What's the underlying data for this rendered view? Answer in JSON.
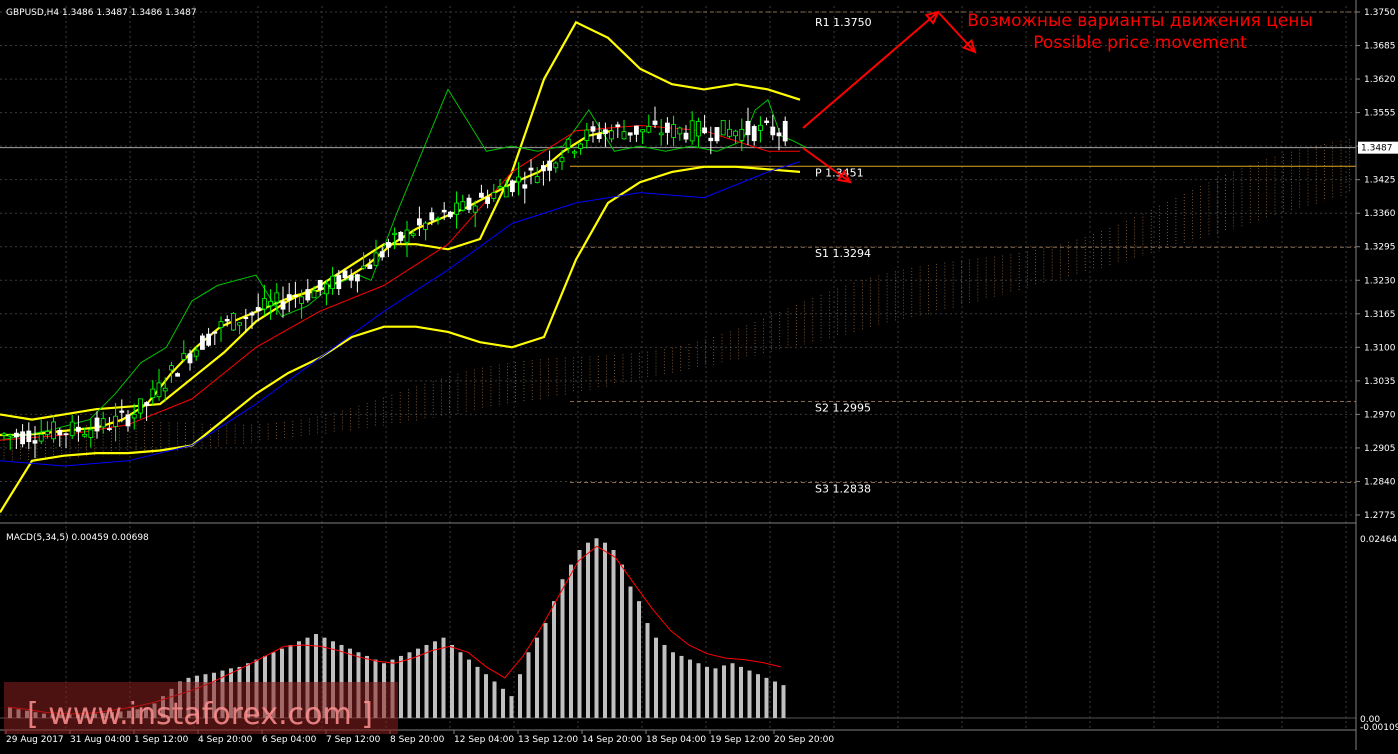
{
  "header": {
    "symbol_info": "GBPUSD,H4  1.3486 1.3487 1.3486 1.3487",
    "macd_info": "MACD(5,34,5) 0.00459 0.00698"
  },
  "annotation": {
    "ru": "Возможные варианты движения цены",
    "en": "Possible price movement"
  },
  "watermark": "[ www.instaforex.com ]",
  "colors": {
    "background": "#000000",
    "grid": "#3a3a3a",
    "bollinger": "#ffff00",
    "green_line": "#00c000",
    "red_line": "#ff0000",
    "blue_line": "#0000ff",
    "cloud": "#f4a460",
    "pivot": "#daa520",
    "histogram": "#c0c0c0",
    "signal": "#ff0000",
    "annotation": "#ff0000",
    "watermark": "#ff6060"
  },
  "chart_data": [
    {
      "type": "line",
      "title": "GBPUSD,H4",
      "ylim": [
        1.2775,
        1.375
      ],
      "grid": true,
      "y_ticks": [
        "1.3750",
        "1.3685",
        "1.3620",
        "1.3555",
        "1.3490",
        "1.3425",
        "1.3360",
        "1.3295",
        "1.3230",
        "1.3165",
        "1.3100",
        "1.3035",
        "1.2970",
        "1.2905",
        "1.2840",
        "1.2775"
      ],
      "x_ticks": [
        "29 Aug 2017",
        "31 Aug 04:00",
        "1 Sep 12:00",
        "4 Sep 20:00",
        "6 Sep 04:00",
        "7 Sep 12:00",
        "8 Sep 20:00",
        "12 Sep 04:00",
        "13 Sep 12:00",
        "14 Sep 20:00",
        "18 Sep 04:00",
        "19 Sep 12:00",
        "20 Sep 20:00"
      ],
      "current_price": "1.3487",
      "pivot_levels": [
        {
          "label": "R1 1.3750",
          "value": 1.375
        },
        {
          "label": "P 1.3451",
          "value": 1.3451
        },
        {
          "label": "S1 1.3294",
          "value": 1.3294
        },
        {
          "label": "S2 1.2995",
          "value": 1.2995
        },
        {
          "label": "S3 1.2838",
          "value": 1.2838
        }
      ],
      "series": [
        {
          "x": [
            0,
            5,
            10,
            15,
            20,
            25,
            30,
            35,
            40,
            45,
            50,
            55,
            60,
            65,
            70,
            75,
            80,
            85,
            90,
            95,
            100,
            105,
            110,
            115,
            120,
            125
          ],
          "values": [
            1.293,
            1.293,
            1.2935,
            1.294,
            1.2945,
            1.296,
            1.299,
            1.305,
            1.31,
            1.314,
            1.316,
            1.318,
            1.32,
            1.321,
            1.323,
            1.326,
            1.33,
            1.333,
            1.335,
            1.337,
            1.3395,
            1.342,
            1.344,
            1.348,
            1.351,
            1.352
          ]
        },
        {
          "x": [
            0,
            5,
            10,
            15,
            20,
            25,
            30,
            35,
            40,
            45,
            50,
            55,
            60,
            65,
            70,
            75,
            80,
            85,
            90,
            95,
            100,
            105,
            110,
            115,
            120,
            125
          ],
          "values": [
            1.297,
            1.296,
            1.297,
            1.298,
            1.2985,
            1.299,
            1.304,
            1.309,
            1.315,
            1.319,
            1.322,
            1.326,
            1.33,
            1.33,
            1.329,
            1.331,
            1.344,
            1.362,
            1.373,
            1.37,
            1.364,
            1.361,
            1.36,
            1.361,
            1.36,
            1.358
          ]
        },
        {
          "x": [
            0,
            5,
            10,
            15,
            20,
            25,
            30,
            35,
            40,
            45,
            50,
            55,
            60,
            65,
            70,
            75,
            80,
            85,
            90,
            95,
            100,
            105,
            110,
            115,
            120,
            125
          ],
          "values": [
            1.278,
            1.288,
            1.289,
            1.2895,
            1.2895,
            1.29,
            1.291,
            1.296,
            1.301,
            1.305,
            1.308,
            1.312,
            1.314,
            1.314,
            1.313,
            1.311,
            1.31,
            1.312,
            1.327,
            1.338,
            1.342,
            1.344,
            1.345,
            1.345,
            1.3445,
            1.344
          ]
        },
        {
          "x": [
            0,
            8,
            14,
            18,
            22,
            26,
            30,
            34,
            40,
            44,
            48,
            52,
            56,
            58,
            62,
            66,
            70,
            72,
            76,
            80,
            84,
            88,
            92,
            96,
            100,
            104,
            108,
            112,
            116,
            118,
            120,
            122,
            124,
            126
          ],
          "values": [
            1.292,
            1.294,
            1.296,
            1.301,
            1.307,
            1.31,
            1.319,
            1.322,
            1.324,
            1.316,
            1.318,
            1.322,
            1.324,
            1.323,
            1.336,
            1.348,
            1.36,
            1.356,
            1.348,
            1.349,
            1.348,
            1.349,
            1.356,
            1.348,
            1.349,
            1.348,
            1.349,
            1.348,
            1.35,
            1.356,
            1.358,
            1.351,
            1.35,
            1.3487
          ]
        },
        {
          "x": [
            0,
            10,
            20,
            30,
            40,
            50,
            60,
            70,
            80,
            90,
            100,
            110,
            120,
            125
          ],
          "values": [
            1.288,
            1.287,
            1.288,
            1.291,
            1.299,
            1.308,
            1.317,
            1.325,
            1.334,
            1.338,
            1.34,
            1.339,
            1.344,
            1.346
          ]
        },
        {
          "x": [
            0,
            10,
            20,
            30,
            40,
            50,
            60,
            70,
            80,
            90,
            100,
            110,
            120,
            125
          ],
          "values": [
            1.292,
            1.293,
            1.295,
            1.3,
            1.31,
            1.317,
            1.322,
            1.33,
            1.344,
            1.352,
            1.353,
            1.352,
            1.348,
            1.348
          ]
        }
      ]
    },
    {
      "type": "bar",
      "title": "MACD(5,34,5) 0.00459 0.00698",
      "y_ticks": [
        "0.02464",
        "0.00",
        "-0.00109"
      ],
      "values": [
        0.0015,
        0.0012,
        0.001,
        0.0008,
        0.0006,
        0.0005,
        0.0005,
        0.0005,
        0.0005,
        0.0005,
        0.0006,
        0.0007,
        0.0008,
        0.0009,
        0.001,
        0.0012,
        0.0014,
        0.002,
        0.003,
        0.004,
        0.005,
        0.0055,
        0.0058,
        0.006,
        0.0062,
        0.0065,
        0.0068,
        0.007,
        0.0075,
        0.008,
        0.0085,
        0.009,
        0.0095,
        0.01,
        0.0105,
        0.011,
        0.0115,
        0.011,
        0.0105,
        0.01,
        0.0095,
        0.009,
        0.0085,
        0.008,
        0.0075,
        0.008,
        0.0085,
        0.009,
        0.0095,
        0.01,
        0.0105,
        0.011,
        0.01,
        0.009,
        0.008,
        0.007,
        0.006,
        0.005,
        0.004,
        0.003,
        0.006,
        0.009,
        0.011,
        0.013,
        0.016,
        0.019,
        0.021,
        0.023,
        0.024,
        0.0246,
        0.024,
        0.023,
        0.021,
        0.018,
        0.016,
        0.013,
        0.011,
        0.01,
        0.009,
        0.0085,
        0.008,
        0.0075,
        0.007,
        0.0068,
        0.0072,
        0.0075,
        0.007,
        0.0065,
        0.006,
        0.0055,
        0.005,
        0.0045
      ],
      "signal": [
        0.0015,
        0.0012,
        0.0008,
        0.0006,
        0.0006,
        0.0008,
        0.0012,
        0.0016,
        0.0022,
        0.003,
        0.0038,
        0.0048,
        0.006,
        0.0072,
        0.0085,
        0.0098,
        0.01,
        0.0098,
        0.0092,
        0.0084,
        0.0078,
        0.0075,
        0.0082,
        0.0092,
        0.0098,
        0.009,
        0.007,
        0.0055,
        0.0085,
        0.0125,
        0.017,
        0.0215,
        0.0235,
        0.022,
        0.0185,
        0.015,
        0.012,
        0.01,
        0.0088,
        0.0082,
        0.008,
        0.0076,
        0.007
      ]
    }
  ]
}
